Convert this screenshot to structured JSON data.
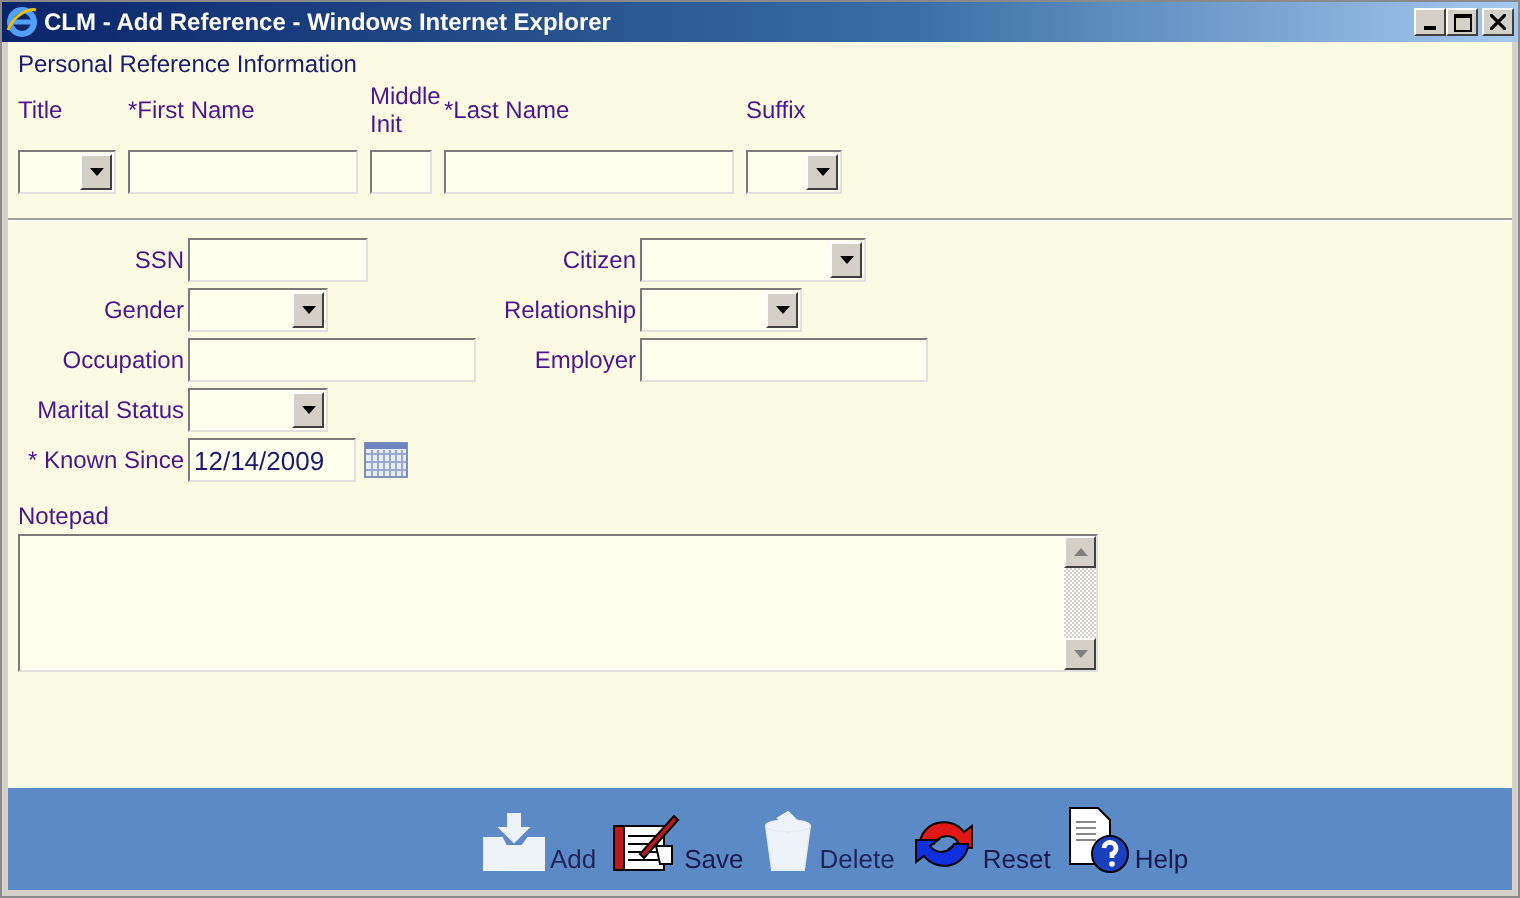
{
  "window": {
    "title": "CLM - Add Reference - Windows Internet Explorer"
  },
  "section_title": "Personal Reference Information",
  "name_fields": [
    {
      "label": "Title",
      "kind": "select"
    },
    {
      "label": "*First Name",
      "kind": "text"
    },
    {
      "label": "Middle Init",
      "kind": "text"
    },
    {
      "label": "*Last Name",
      "kind": "text"
    },
    {
      "label": "Suffix",
      "kind": "select"
    }
  ],
  "detail_rows": [
    {
      "left": {
        "label": "SSN",
        "kind": "text"
      },
      "right": {
        "label": "Citizen",
        "kind": "select"
      }
    },
    {
      "left": {
        "label": "Gender",
        "kind": "select"
      },
      "right": {
        "label": "Relationship",
        "kind": "select"
      }
    },
    {
      "left": {
        "label": "Occupation",
        "kind": "text"
      },
      "right": {
        "label": "Employer",
        "kind": "text"
      }
    },
    {
      "left": {
        "label": "Marital Status",
        "kind": "select"
      }
    },
    {
      "left": {
        "label": "* Known Since",
        "kind": "date",
        "value": "12/14/2009"
      }
    }
  ],
  "notepad": {
    "label": "Notepad"
  },
  "toolbar": [
    {
      "label": "Add",
      "kind": "add",
      "disabled": true
    },
    {
      "label": "Save",
      "kind": "save",
      "disabled": false
    },
    {
      "label": "Delete",
      "kind": "delete",
      "disabled": true
    },
    {
      "label": "Reset",
      "kind": "reset",
      "disabled": false
    },
    {
      "label": "Help",
      "kind": "help",
      "disabled": false
    }
  ]
}
